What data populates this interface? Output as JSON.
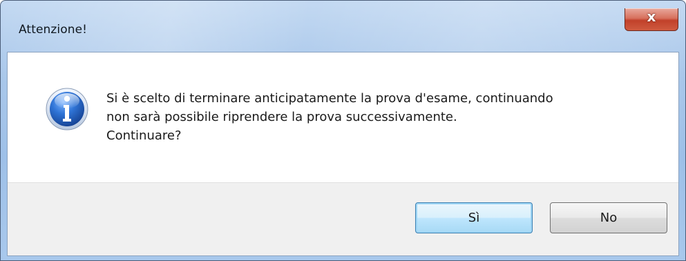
{
  "window": {
    "title": "Attenzione!",
    "close_glyph": "x"
  },
  "dialog": {
    "icon": "info-icon",
    "message_lines": [
      "Si è scelto di terminare anticipatamente la prova d'esame, continuando",
      "non sarà possibile riprendere la prova successivamente.",
      "Continuare?"
    ]
  },
  "buttons": {
    "yes_label": "Sì",
    "no_label": "No"
  },
  "colors": {
    "titlebar": "#a9c7ea",
    "close_button": "#c1412a",
    "info_icon": "#1f5fbf",
    "default_button_border": "#3c7fb1"
  }
}
